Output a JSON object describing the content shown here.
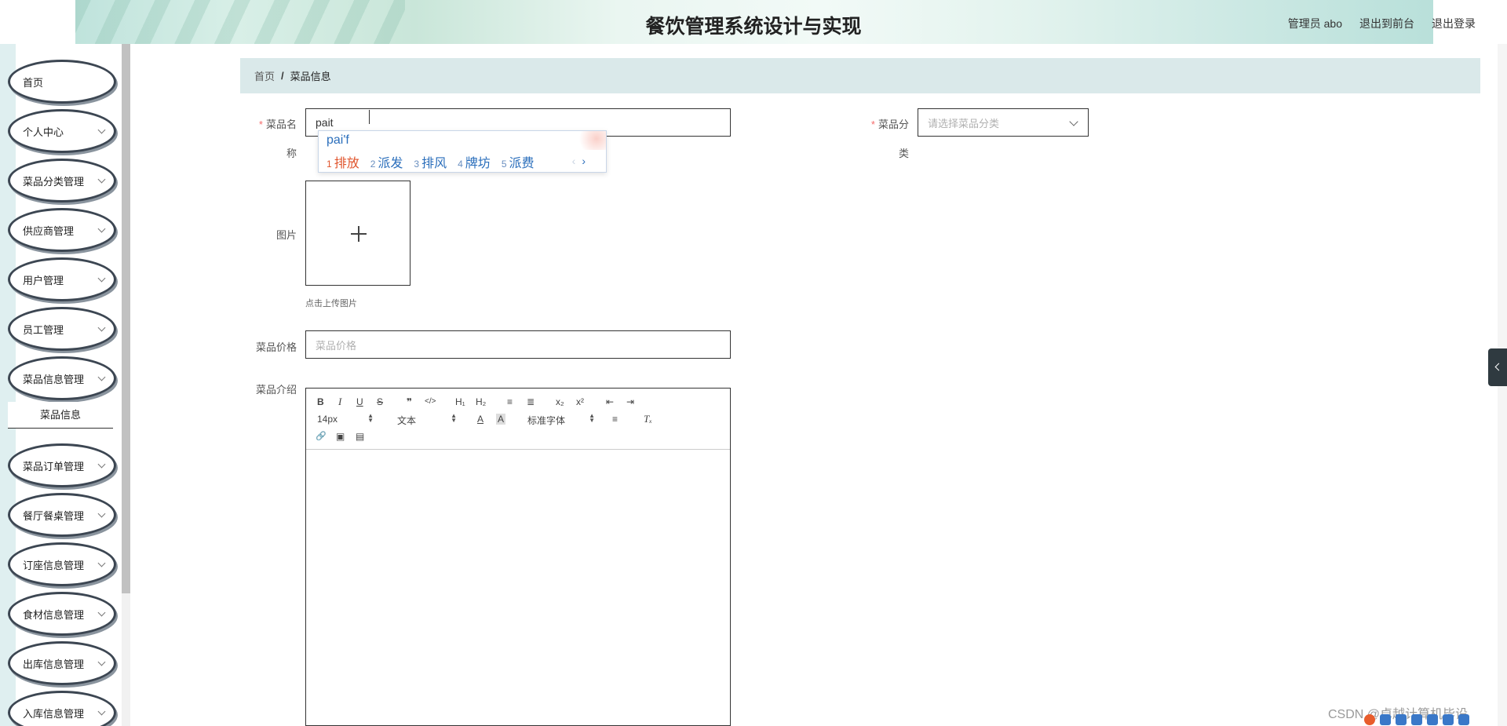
{
  "header": {
    "title": "餐饮管理系统设计与实现",
    "user_label": "管理员 abo",
    "front_label": "退出到前台",
    "logout_label": "退出登录"
  },
  "sidebar": {
    "items": [
      {
        "label": "首页"
      },
      {
        "label": "个人中心"
      },
      {
        "label": "菜品分类管理"
      },
      {
        "label": "供应商管理"
      },
      {
        "label": "用户管理"
      },
      {
        "label": "员工管理"
      },
      {
        "label": "菜品信息管理"
      },
      {
        "label": "菜品订单管理"
      },
      {
        "label": "餐厅餐桌管理"
      },
      {
        "label": "订座信息管理"
      },
      {
        "label": "食材信息管理"
      },
      {
        "label": "出库信息管理"
      },
      {
        "label": "入库信息管理"
      }
    ],
    "submenu_label": "菜品信息"
  },
  "breadcrumb": {
    "home": "首页",
    "separator": "/",
    "current": "菜品信息"
  },
  "form": {
    "name_label_a": "菜品名",
    "name_label_b": "称",
    "name_value": "pait",
    "category_label_a": "菜品分",
    "category_label_b": "类",
    "category_placeholder": "请选择菜品分类",
    "image_label": "图片",
    "upload_tip": "点击上传图片",
    "price_label": "菜品价格",
    "price_placeholder": "菜品价格",
    "intro_label": "菜品介绍",
    "required_mark": "*"
  },
  "ime": {
    "pinyin": "pai'f",
    "candidates": [
      {
        "n": "1",
        "text": "排放"
      },
      {
        "n": "2",
        "text": "派发"
      },
      {
        "n": "3",
        "text": "排风"
      },
      {
        "n": "4",
        "text": "牌坊"
      },
      {
        "n": "5",
        "text": "派费"
      }
    ],
    "prev": "‹",
    "next": "›"
  },
  "editor": {
    "font_size": "14px",
    "block_type": "文本",
    "font_family": "标准字体",
    "buttons": {
      "bold": "B",
      "italic": "I",
      "underline": "U",
      "strike": "S",
      "quote": "❞",
      "code": "</>",
      "h1": "H₁",
      "h2": "H₂",
      "ol": "≡",
      "ul": "≣",
      "sub": "x₂",
      "sup": "x²",
      "outdent": "⇤",
      "indent": "⇥",
      "color": "A",
      "bg": "A",
      "align": "≡",
      "clean": "Tₓ",
      "link": "🔗",
      "image": "▣",
      "video": "▤"
    }
  },
  "watermark": "CSDN @卓越计算机毕设"
}
